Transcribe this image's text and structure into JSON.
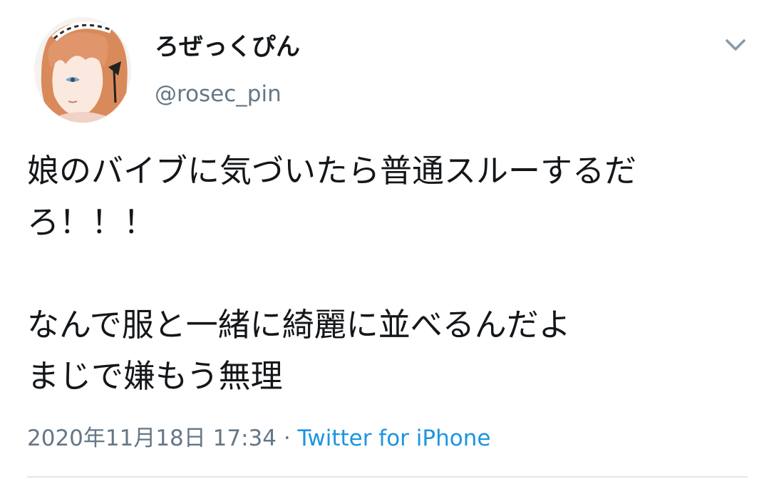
{
  "user": {
    "display_name": "ろぜっくぴん",
    "handle": "@rosec_pin",
    "avatar_icon": "avatar-anime-maid-girl"
  },
  "menu_icon": "chevron-down-icon",
  "tweet": {
    "lines": [
      "娘のバイブに気づいたら普通スルーするだ",
      "ろ！！！",
      "",
      "なんで服と一緒に綺麗に並べるんだよ",
      "まじで嫌もう無理"
    ]
  },
  "meta": {
    "timestamp": "2020年11月18日 17:34",
    "separator": " · ",
    "source": "Twitter for iPhone"
  },
  "colors": {
    "text": "#14171a",
    "secondary": "#657786",
    "link": "#1b95e0",
    "divider": "#e1e8ed"
  }
}
